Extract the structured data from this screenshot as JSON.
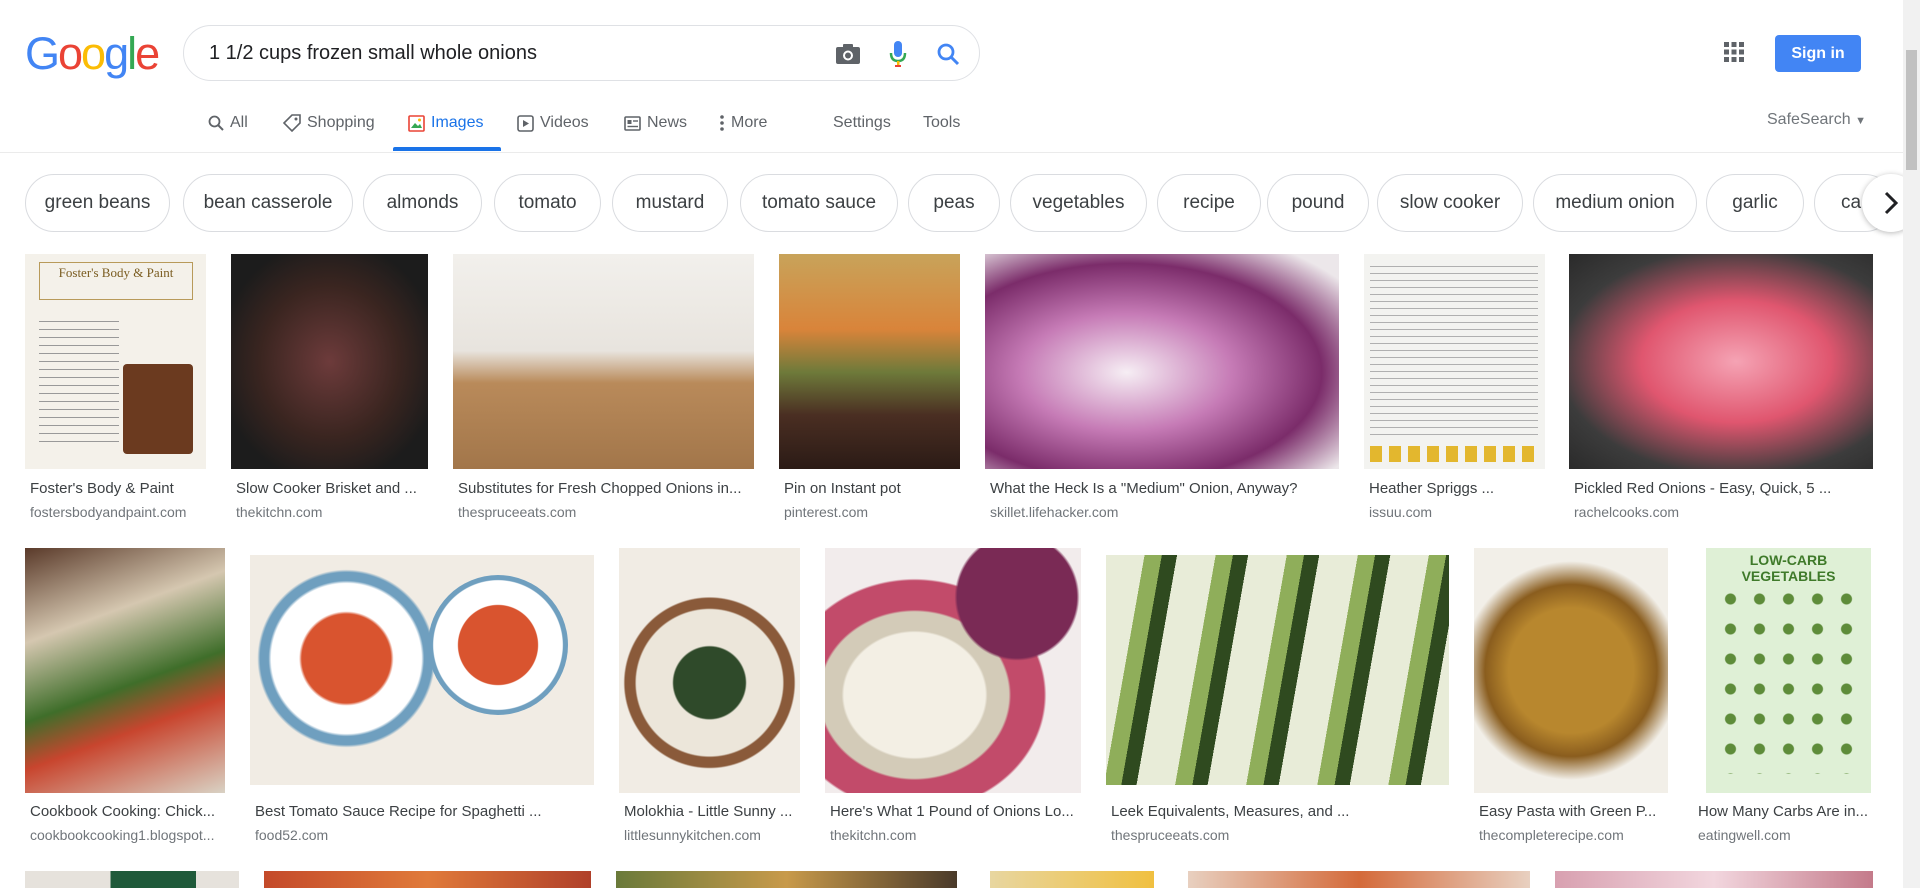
{
  "search": {
    "query": "1 1/2 cups frozen small whole onions"
  },
  "header": {
    "sign_in_label": "Sign in"
  },
  "logo": {
    "letters": [
      "G",
      "o",
      "o",
      "g",
      "l",
      "e"
    ]
  },
  "tabs": [
    {
      "label": "All"
    },
    {
      "label": "Shopping"
    },
    {
      "label": "Images"
    },
    {
      "label": "Videos"
    },
    {
      "label": "News"
    },
    {
      "label": "More"
    },
    {
      "label": "Settings"
    },
    {
      "label": "Tools"
    }
  ],
  "safesearch": {
    "label": "SafeSearch"
  },
  "chips": [
    "green beans",
    "bean casserole",
    "almonds",
    "tomato",
    "mustard",
    "tomato sauce",
    "peas",
    "vegetables",
    "recipe",
    "pound",
    "slow cooker",
    "medium onion",
    "garlic",
    "ca"
  ],
  "results": [
    {
      "title": "Foster's Body & Paint",
      "source": "fostersbodyandpaint.com",
      "image_text": "Foster's Body & Paint"
    },
    {
      "title": "Slow Cooker Brisket and ...",
      "source": "thekitchn.com"
    },
    {
      "title": "Substitutes for Fresh Chopped Onions in...",
      "source": "thespruceeats.com"
    },
    {
      "title": "Pin on Instant pot",
      "source": "pinterest.com"
    },
    {
      "title": "What the Heck Is a \"Medium\" Onion, Anyway?",
      "source": "skillet.lifehacker.com"
    },
    {
      "title": "Heather Spriggs ...",
      "source": "issuu.com"
    },
    {
      "title": "Pickled Red Onions - Easy, Quick, 5 ...",
      "source": "rachelcooks.com"
    },
    {
      "title": "Cookbook Cooking: Chick...",
      "source": "cookbookcooking1.blogspot..."
    },
    {
      "title": "Best Tomato Sauce Recipe for Spaghetti ...",
      "source": "food52.com"
    },
    {
      "title": "Molokhia - Little Sunny ...",
      "source": "littlesunnykitchen.com"
    },
    {
      "title": "Here's What 1 Pound of Onions Lo...",
      "source": "thekitchn.com"
    },
    {
      "title": "Leek Equivalents, Measures, and ...",
      "source": "thespruceeats.com"
    },
    {
      "title": "Easy Pasta with Green P...",
      "source": "thecompleterecipe.com"
    },
    {
      "title": "How Many Carbs Are in...",
      "source": "eatingwell.com",
      "image_text": "LOW-CARB VEGETABLES"
    }
  ],
  "colors": {
    "accent": "#1a73e8",
    "button": "#4285f4",
    "logo": [
      "#4285f4",
      "#ea4335",
      "#fbbc05",
      "#4285f4",
      "#34a853",
      "#ea4335"
    ]
  }
}
